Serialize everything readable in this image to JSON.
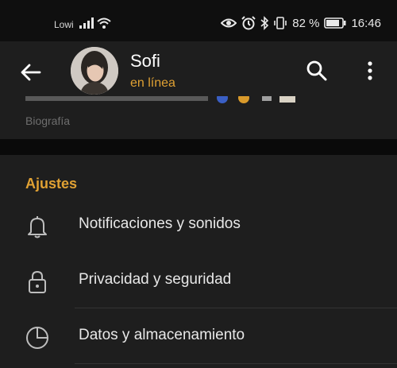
{
  "status_bar": {
    "carrier": "Lowi",
    "battery_percent": "82 %",
    "time": "16:46",
    "icons": [
      "signal-icon",
      "wifi-icon",
      "eye-icon",
      "alarm-icon",
      "bluetooth-icon",
      "vibrate-icon",
      "battery-icon"
    ]
  },
  "header": {
    "contact_name": "Sofi",
    "contact_status": "en línea",
    "icons": [
      "back-arrow-icon",
      "search-icon",
      "more-vert-icon"
    ]
  },
  "bio": {
    "label": "Biografía"
  },
  "settings": {
    "title": "Ajustes",
    "items": [
      {
        "label": "Notificaciones y sonidos",
        "icon": "bell-icon"
      },
      {
        "label": "Privacidad y seguridad",
        "icon": "lock-icon"
      },
      {
        "label": "Datos y almacenamiento",
        "icon": "pie-chart-icon"
      }
    ]
  },
  "colors": {
    "accent": "#e0a133",
    "surface": "#1e1e1e",
    "background": "#0f0f0f",
    "text_primary": "#e8e8e8",
    "text_secondary": "#6e6e6e"
  }
}
